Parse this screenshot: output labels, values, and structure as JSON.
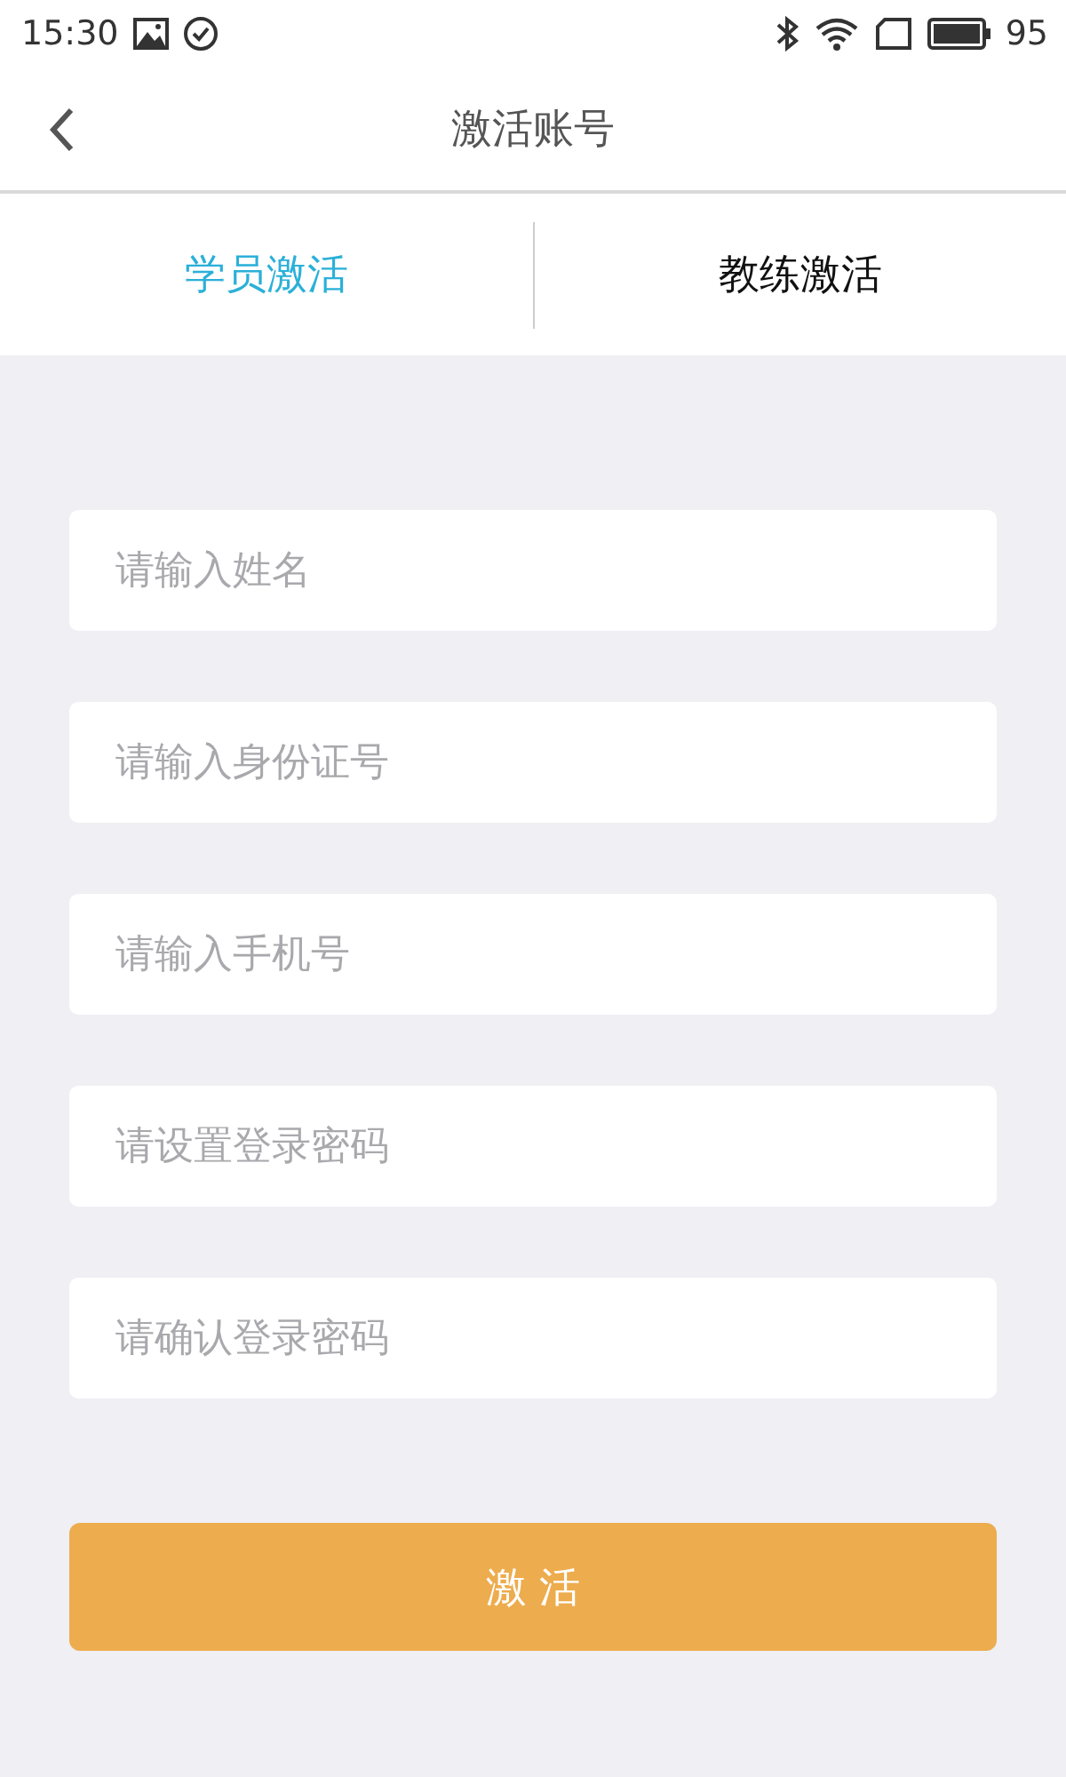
{
  "status_bar": {
    "time": "15:30",
    "battery": "95"
  },
  "header": {
    "title": "激活账号"
  },
  "tabs": [
    {
      "label": "学员激活",
      "selected": true
    },
    {
      "label": "教练激活",
      "selected": false
    }
  ],
  "fields": [
    {
      "placeholder": "请输入姓名"
    },
    {
      "placeholder": "请输入身份证号"
    },
    {
      "placeholder": "请输入手机号"
    },
    {
      "placeholder": "请设置登录密码"
    },
    {
      "placeholder": "请确认登录密码"
    }
  ],
  "submit_button": "激 活"
}
